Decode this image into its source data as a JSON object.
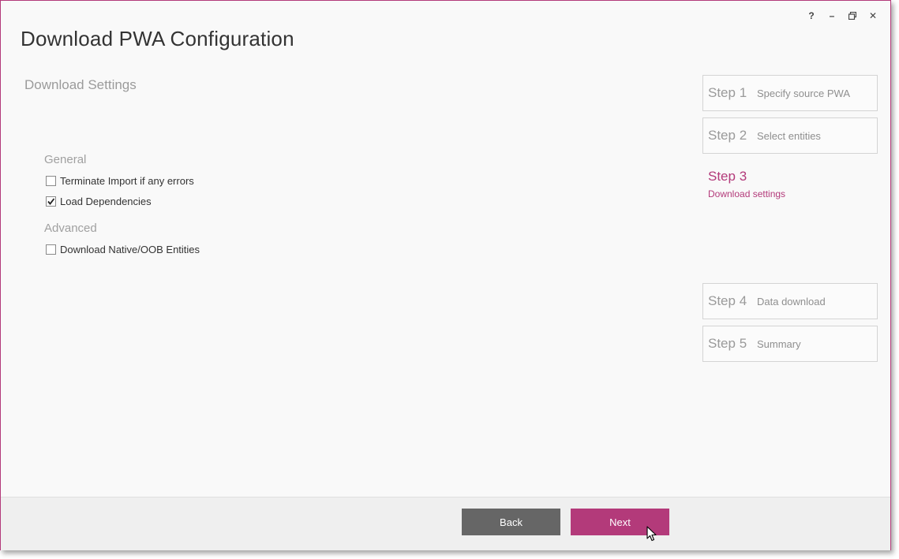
{
  "window": {
    "controls": {
      "help_label": "?",
      "minimize_label": "–",
      "maximize_icon": "restore-icon",
      "close_label": "✕"
    },
    "title": "Download PWA Configuration"
  },
  "page": {
    "subtitle": "Download Settings",
    "general": {
      "label": "General",
      "options": [
        {
          "label": "Terminate Import if any errors",
          "checked": false
        },
        {
          "label": "Load Dependencies",
          "checked": true
        }
      ]
    },
    "advanced": {
      "label": "Advanced",
      "options": [
        {
          "label": "Download Native/OOB Entities",
          "checked": false
        }
      ]
    }
  },
  "steps": [
    {
      "num": "Step 1",
      "desc": "Specify source PWA",
      "active": false
    },
    {
      "num": "Step 2",
      "desc": "Select entities",
      "active": false
    },
    {
      "num": "Step 3",
      "desc": "Download settings",
      "active": true
    },
    {
      "num": "Step 4",
      "desc": "Data download",
      "active": false
    },
    {
      "num": "Step 5",
      "desc": "Summary",
      "active": false
    }
  ],
  "footer": {
    "back_label": "Back",
    "next_label": "Next"
  },
  "colors": {
    "accent": "#b33a7a",
    "back_button": "#666666",
    "background": "#f9f9f9"
  }
}
